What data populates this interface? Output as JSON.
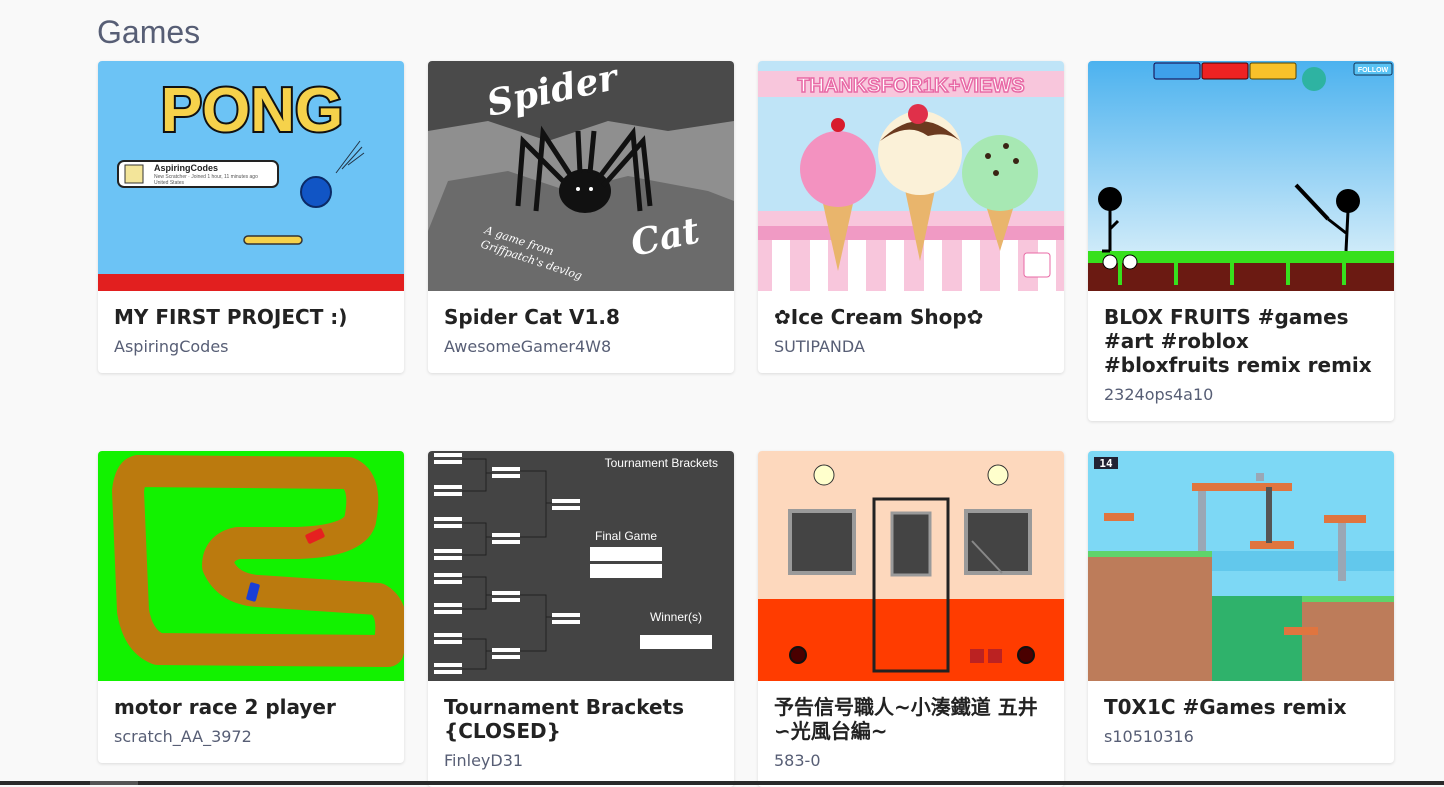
{
  "section": {
    "title": "Games"
  },
  "projects": [
    {
      "title": "MY FIRST PROJECT :)",
      "author": "AspiringCodes",
      "thumb": {
        "pong_text": "PONG",
        "badge_name": "AspiringCodes",
        "badge_line1": "New Scratcher · Joined 1 hour, 11 minutes ago",
        "badge_line2": "United States"
      }
    },
    {
      "title": "Spider Cat V1.8",
      "author": "AwesomeGamer4W8",
      "thumb": {
        "word1": "Spider",
        "word2": "Cat",
        "caption1": "A game from",
        "caption2": "Griffpatch's devlog"
      }
    },
    {
      "title": "✿Ice Cream Shop✿",
      "author": "SUTIPANDA",
      "thumb": {
        "banner": "THANKSFOR1K+VIEWS"
      }
    },
    {
      "title": "BLOX FRUITS #games #art #roblox #bloxfruits remix remix",
      "author": "2324ops4a10",
      "thumb": {
        "follow": "FOLLOW"
      }
    },
    {
      "title": "motor race 2 player",
      "author": "scratch_AA_3972",
      "thumb": {}
    },
    {
      "title": "Tournament Brackets {CLOSED}",
      "author": "FinleyD31",
      "thumb": {
        "heading": "Tournament Brackets",
        "final": "Final Game",
        "winner": "Winner(s)"
      }
    },
    {
      "title": "予告信号職人~小湊鐵道 五井∽光風台編~",
      "author": "583-0",
      "thumb": {}
    },
    {
      "title": "T0X1C #Games remix",
      "author": "s10510316",
      "thumb": {
        "counter": "14"
      }
    }
  ],
  "colors": {
    "title_text": "#222222",
    "author_text": "#575e75",
    "background": "#f9f9f9"
  }
}
